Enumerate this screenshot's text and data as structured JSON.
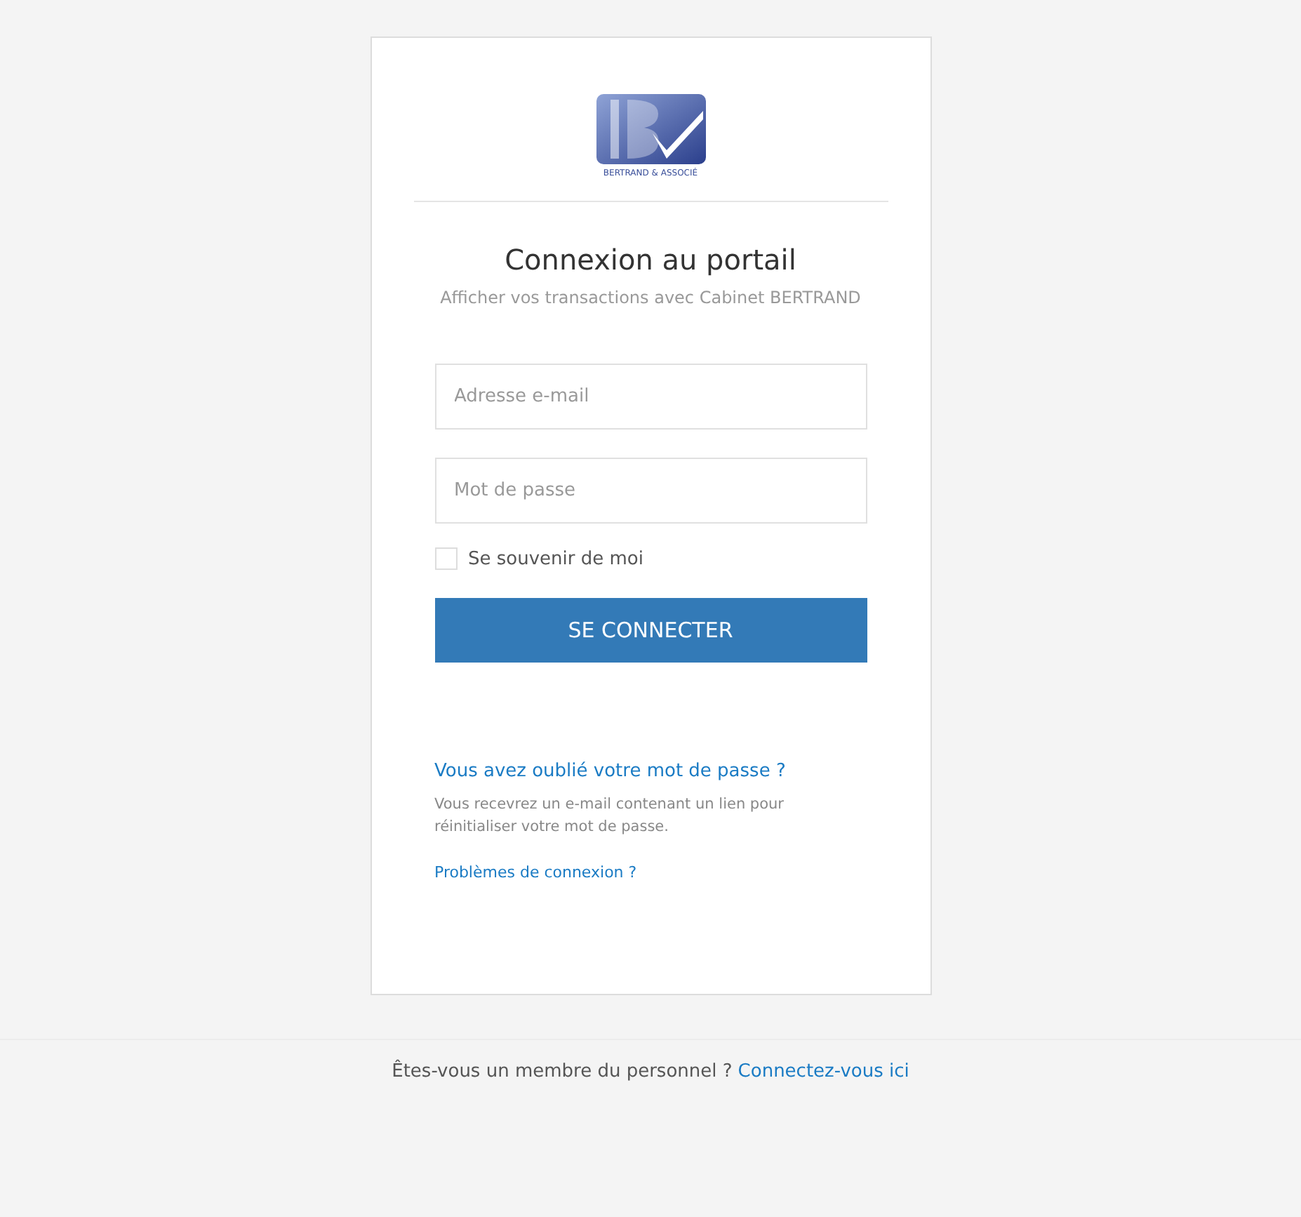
{
  "logo": {
    "caption": "BERTRAND & ASSOCIÉ"
  },
  "heading": "Connexion au portail",
  "subtitle": "Afficher vos transactions avec Cabinet BERTRAND",
  "fields": [
    {
      "placeholder": "Adresse e-mail"
    },
    {
      "placeholder": "Mot de passe"
    }
  ],
  "remember": {
    "label": "Se souvenir de moi",
    "checked": false
  },
  "submit": "SE CONNECTER",
  "forgot": {
    "link": "Vous avez oublié votre mot de passe ?",
    "note": "Vous recevrez un e-mail contenant un lien pour réinitialiser votre mot de passe."
  },
  "problems_link": "Problèmes de connexion ?",
  "footer": {
    "text": "Êtes-vous un membre du personnel ?",
    "link": "Connectez-vous ici"
  }
}
